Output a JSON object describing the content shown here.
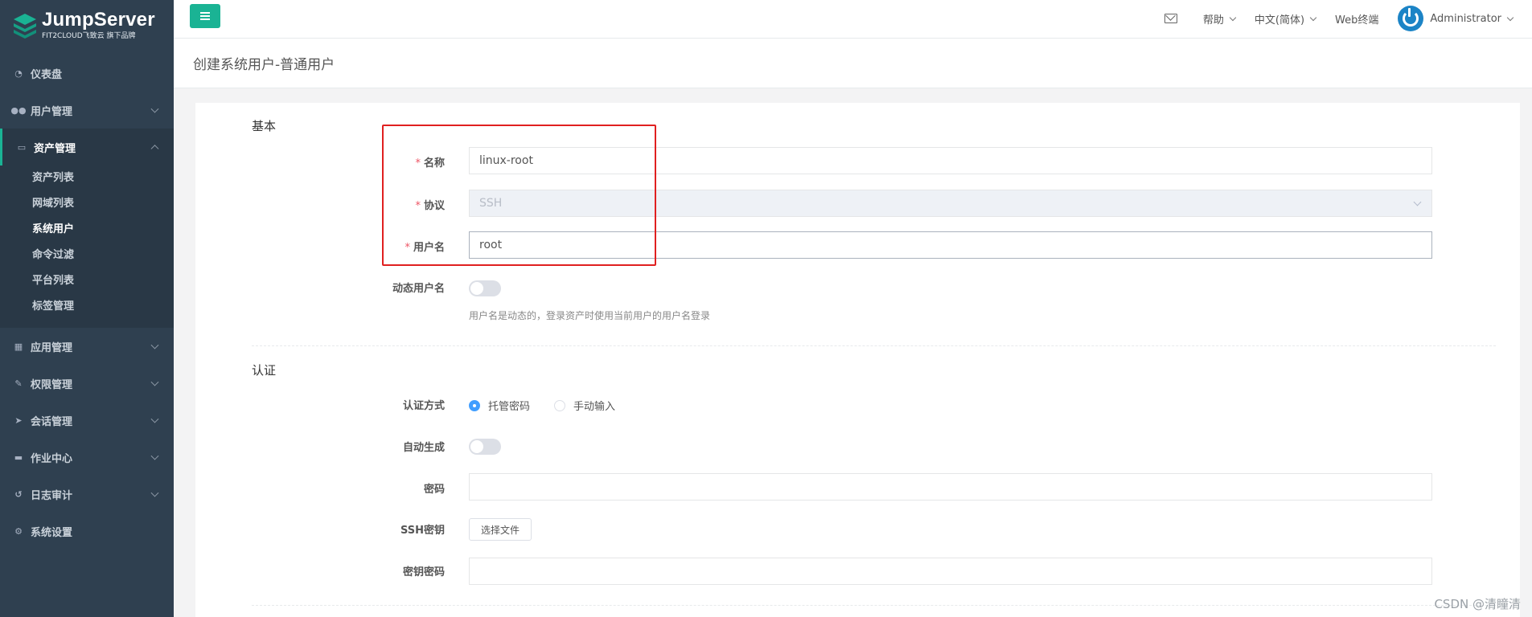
{
  "brand": {
    "title": "JumpServer",
    "subtitle": "FIT2CLOUD飞致云 旗下品牌"
  },
  "sidebar": {
    "items": [
      {
        "label": "仪表盘",
        "icon": "dashboard-icon"
      },
      {
        "label": "用户管理",
        "icon": "users-icon"
      },
      {
        "label": "资产管理",
        "icon": "inbox-icon",
        "expanded": true,
        "children": [
          "资产列表",
          "网域列表",
          "系统用户",
          "命令过滤",
          "平台列表",
          "标签管理"
        ],
        "current": "系统用户"
      },
      {
        "label": "应用管理",
        "icon": "grid-icon"
      },
      {
        "label": "权限管理",
        "icon": "edit-icon"
      },
      {
        "label": "会话管理",
        "icon": "rocket-icon"
      },
      {
        "label": "作业中心",
        "icon": "keyboard-icon"
      },
      {
        "label": "日志审计",
        "icon": "history-icon"
      },
      {
        "label": "系统设置",
        "icon": "gears-icon"
      }
    ]
  },
  "topbar": {
    "help": "帮助",
    "language": "中文(简体)",
    "web_terminal": "Web终端",
    "user": "Administrator"
  },
  "page": {
    "title": "创建系统用户-普通用户"
  },
  "form": {
    "basic_section": "基本",
    "name_label": "名称",
    "name_value": "linux-root",
    "protocol_label": "协议",
    "protocol_value": "SSH",
    "username_label": "用户名",
    "username_value": "root",
    "dynamic_username_label": "动态用户名",
    "dynamic_username_hint": "用户名是动态的，登录资产时使用当前用户的用户名登录",
    "auth_section": "认证",
    "auth_method_label": "认证方式",
    "auth_option_managed": "托管密码",
    "auth_option_manual": "手动输入",
    "auto_generate_label": "自动生成",
    "password_label": "密码",
    "ssh_key_label": "SSH密钥",
    "choose_file": "选择文件",
    "key_password_label": "密钥密码"
  },
  "watermark": "CSDN @清瞳清",
  "colors": {
    "sidebar": "#2f4050",
    "accent": "#1ab394",
    "highlight": "#e02020",
    "radio": "#409eff"
  }
}
